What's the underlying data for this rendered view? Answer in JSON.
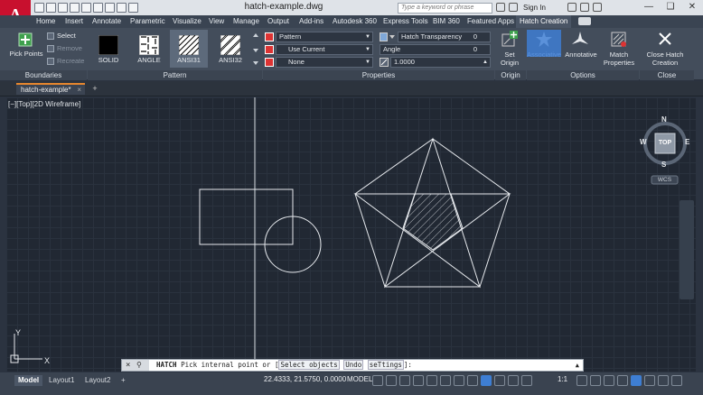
{
  "app": {
    "window_title": "hatch-example.dwg",
    "search_placeholder": "Type a keyword or phrase",
    "signin_label": "Sign In"
  },
  "ribbon_tabs": [
    "Home",
    "Insert",
    "Annotate",
    "Parametric",
    "Visualize",
    "View",
    "Manage",
    "Output",
    "Add-ins",
    "Autodesk 360",
    "Express Tools",
    "BIM 360",
    "Featured Apps",
    "Hatch Creation"
  ],
  "active_ribbon_tab": "Hatch Creation",
  "boundaries": {
    "label": "Boundaries",
    "pick_points": "Pick Points",
    "select": "Select",
    "remove": "Remove",
    "recreate": "Recreate"
  },
  "pattern_panel": {
    "label": "Pattern",
    "patterns": [
      "SOLID",
      "ANGLE",
      "ANSI31",
      "ANSI32"
    ],
    "selected": "ANSI31"
  },
  "properties_panel": {
    "label": "Properties",
    "type_value": "Pattern",
    "color_value": "Use Current",
    "background_value": "None",
    "transparency_label": "Hatch Transparency",
    "transparency_value": "0",
    "angle_label": "Angle",
    "angle_value": "0",
    "scale_value": "1.0000"
  },
  "origin_panel": {
    "label": "Origin",
    "set_origin": "Set Origin"
  },
  "options_panel": {
    "label": "Options",
    "associative": "Associative",
    "annotative": "Annotative",
    "match_properties": "Match Properties"
  },
  "close_panel": {
    "label": "Close",
    "close_hatch": "Close Hatch Creation"
  },
  "file_tab": {
    "name": "hatch-example*"
  },
  "viewport": {
    "label": "[−][Top][2D Wireframe]",
    "viewcube": {
      "top": "TOP",
      "n": "N",
      "s": "S",
      "e": "E",
      "w": "W",
      "wcs": "WCS"
    },
    "ucs": {
      "x": "X",
      "y": "Y"
    }
  },
  "command_line": {
    "command": "HATCH",
    "prompt": "Pick internal point or [",
    "options": [
      "Select objects",
      "Undo",
      "seTtings"
    ],
    "suffix": "]:"
  },
  "status_bar": {
    "layout_tabs": [
      "Model",
      "Layout1",
      "Layout2"
    ],
    "active_layout": "Model",
    "coordinates": "22.4333, 21.5750, 0.0000",
    "space": "MODEL",
    "scale": "1:1"
  },
  "colors": {
    "accent_blue": "#3e7ed3",
    "autocad_red": "#c8102e",
    "active_tab_orange": "#e6862e",
    "canvas_bg": "#212833"
  }
}
